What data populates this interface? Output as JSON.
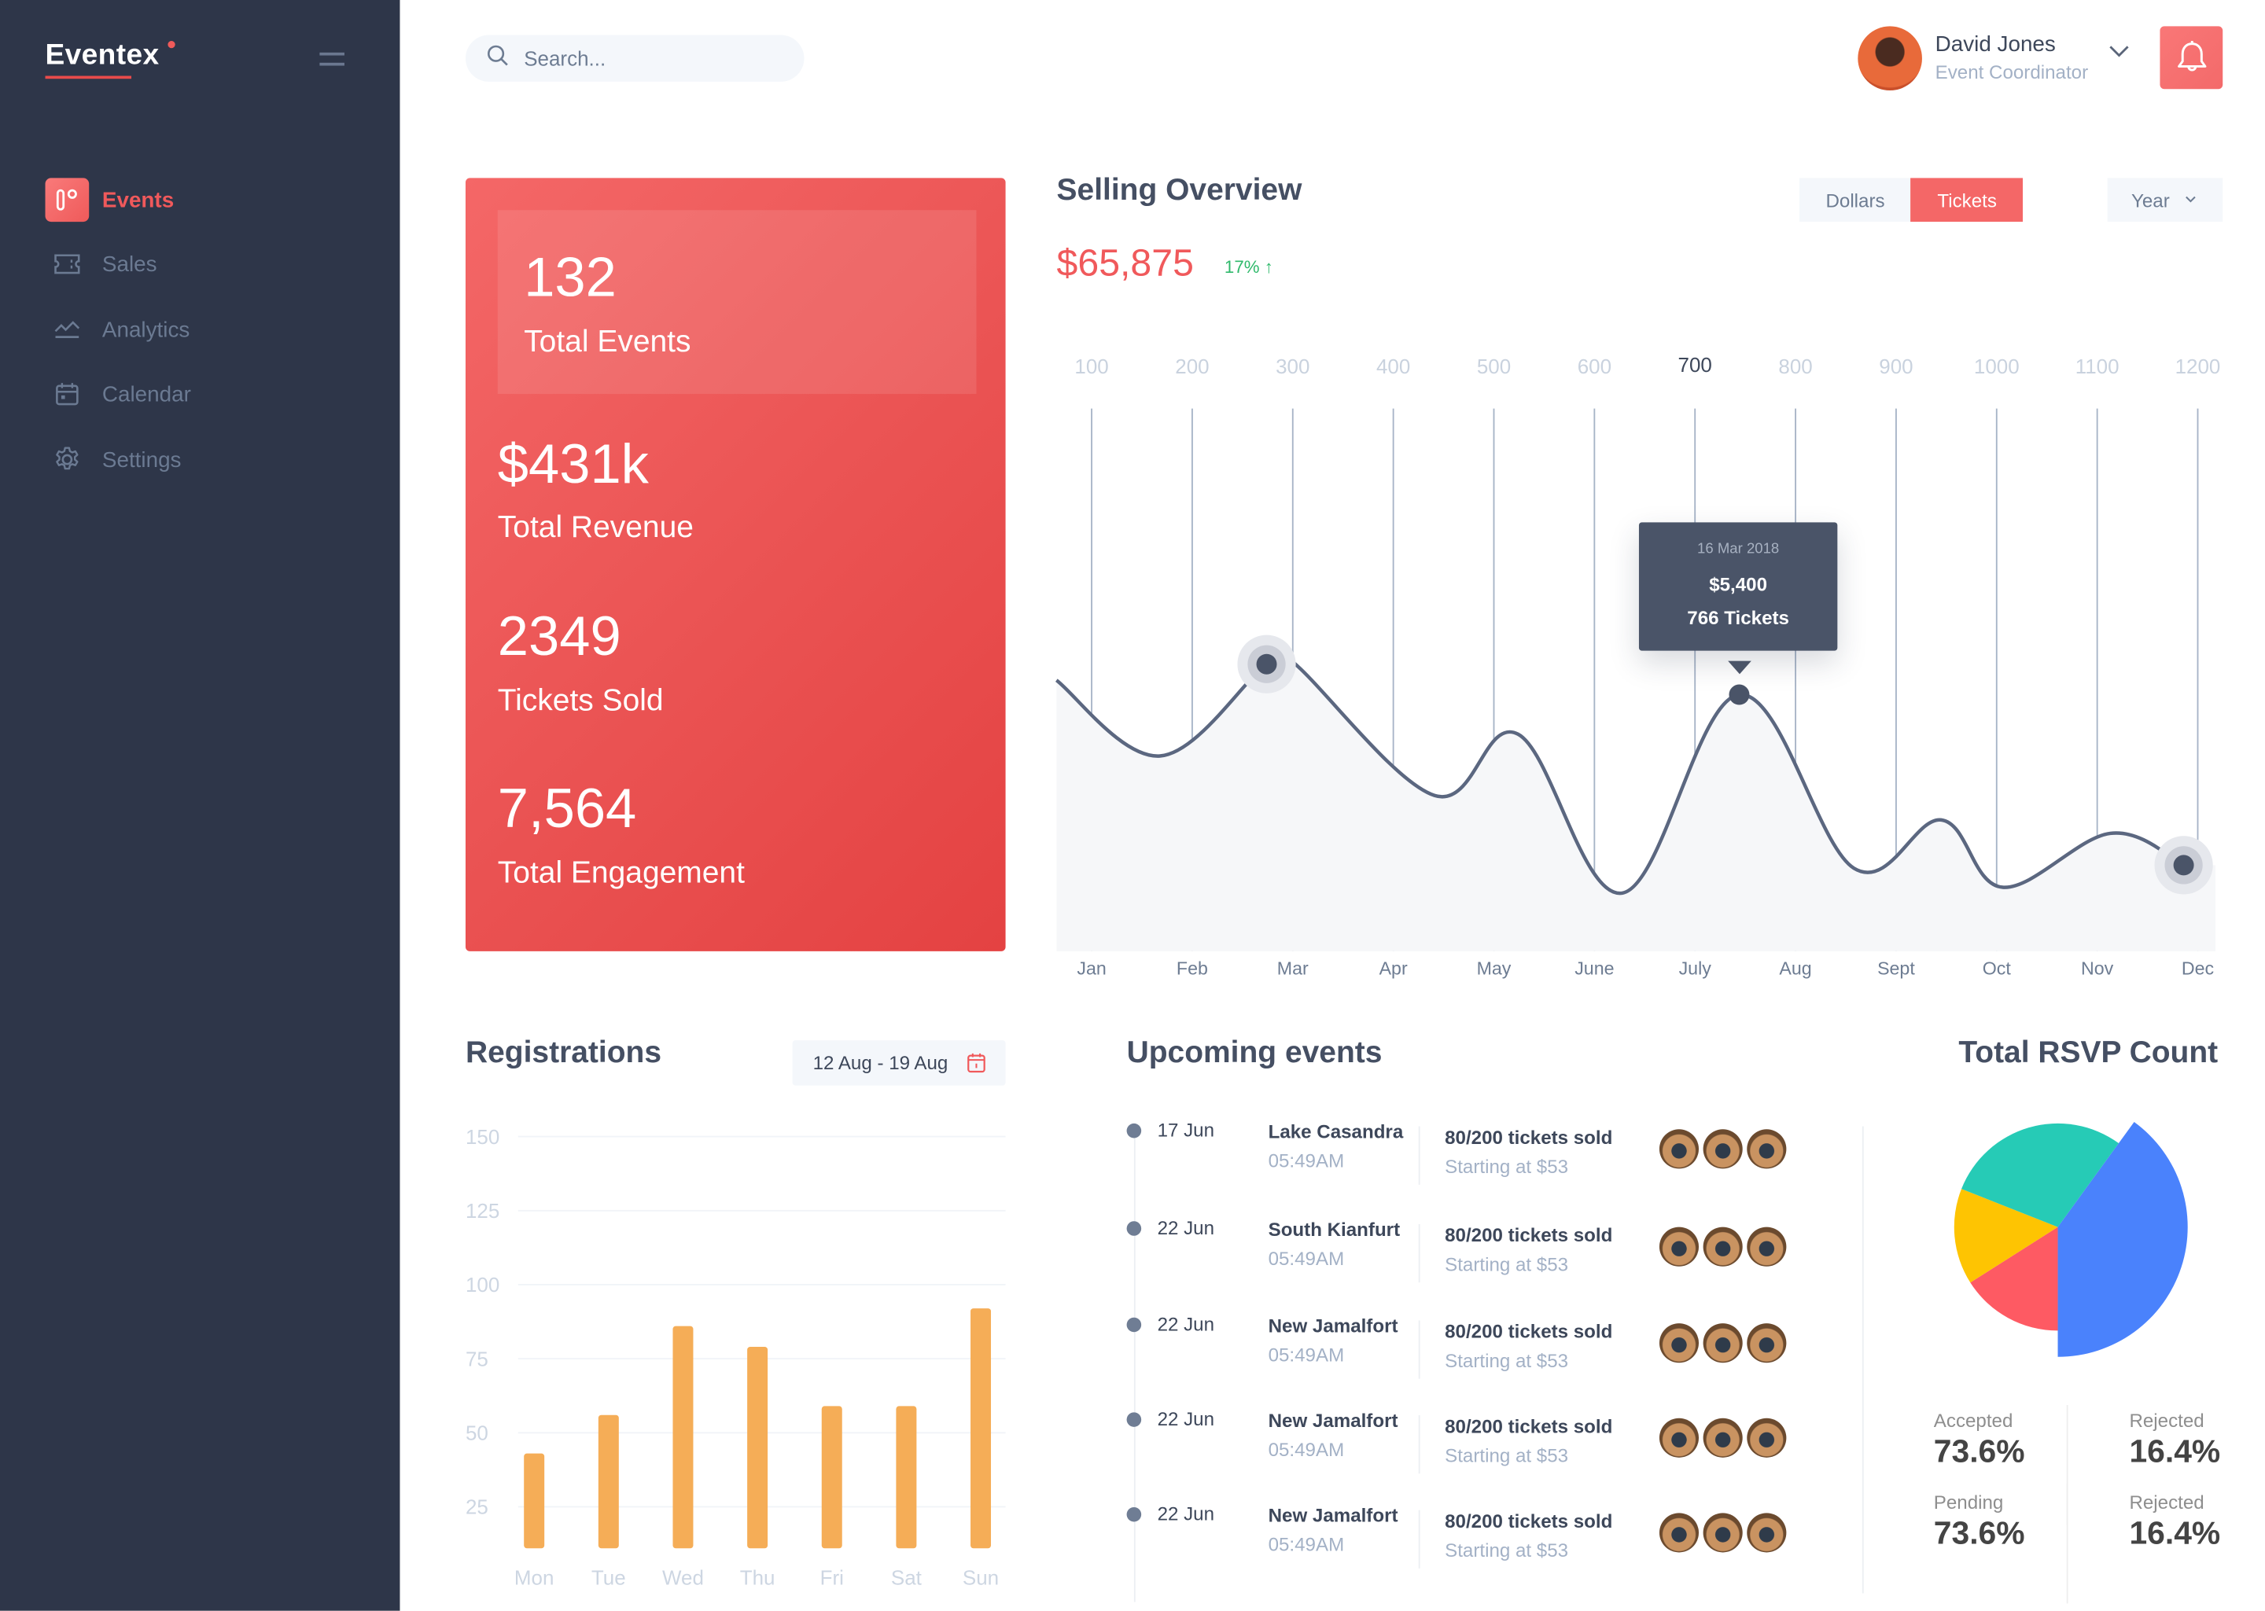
{
  "app": {
    "name": "Eventex"
  },
  "sidebar": {
    "items": [
      {
        "label": "Events",
        "icon": "events-icon",
        "active": true
      },
      {
        "label": "Sales",
        "icon": "ticket-icon",
        "active": false
      },
      {
        "label": "Analytics",
        "icon": "analytics-icon",
        "active": false
      },
      {
        "label": "Calendar",
        "icon": "calendar-icon",
        "active": false
      },
      {
        "label": "Settings",
        "icon": "gear-icon",
        "active": false
      }
    ]
  },
  "header": {
    "search": {
      "placeholder": "Search...",
      "value": ""
    },
    "user": {
      "name": "David Jones",
      "role": "Event Coordinator"
    },
    "notification_icon": "bell-icon"
  },
  "colors": {
    "accent": "#f0595b",
    "sidebar_bg": "#2e3649",
    "bar": "#f5ad57",
    "positive": "#2fb96b",
    "line": "#5b6780"
  },
  "stats": [
    {
      "value": "132",
      "label": "Total Events"
    },
    {
      "value": "$431k",
      "label": "Total Revenue"
    },
    {
      "value": "2349",
      "label": "Tickets Sold"
    },
    {
      "value": "7,564",
      "label": "Total Engagement"
    }
  ],
  "selling": {
    "title": "Selling Overview",
    "amount": "$65,875",
    "change": "17% ↑",
    "toggle": [
      {
        "label": "Dollars",
        "selected": false
      },
      {
        "label": "Tickets",
        "selected": true
      }
    ],
    "period": "Year",
    "tooltip": {
      "date": "16 Mar 2018",
      "amount": "$5,400",
      "tickets": "766 Tickets"
    }
  },
  "registrations": {
    "title": "Registrations",
    "date_range": "12 Aug - 19 Aug"
  },
  "upcoming": {
    "title": "Upcoming events",
    "events": [
      {
        "date": "17 Jun",
        "place": "Lake Casandra",
        "time": "05:49AM",
        "sold": "80/200 tickets sold",
        "price": "Starting at $53"
      },
      {
        "date": "22 Jun",
        "place": "South Kianfurt",
        "time": "05:49AM",
        "sold": "80/200 tickets sold",
        "price": "Starting at $53"
      },
      {
        "date": "22 Jun",
        "place": "New Jamalfort",
        "time": "05:49AM",
        "sold": "80/200 tickets sold",
        "price": "Starting at $53"
      },
      {
        "date": "22 Jun",
        "place": "New Jamalfort",
        "time": "05:49AM",
        "sold": "80/200 tickets sold",
        "price": "Starting at $53"
      },
      {
        "date": "22 Jun",
        "place": "New Jamalfort",
        "time": "05:49AM",
        "sold": "80/200 tickets sold",
        "price": "Starting at $53"
      }
    ]
  },
  "rsvp": {
    "title": "Total RSVP Count",
    "stats": [
      {
        "label": "Accepted",
        "value": "73.6%"
      },
      {
        "label": "Rejected",
        "value": "16.4%"
      },
      {
        "label": "Pending",
        "value": "73.6%"
      },
      {
        "label": "Rejected",
        "value": "16.4%"
      }
    ]
  },
  "chart_data": [
    {
      "type": "line",
      "title": "Selling Overview",
      "categories": [
        "Jan",
        "Feb",
        "Mar",
        "Apr",
        "May",
        "June",
        "July",
        "Aug",
        "Sept",
        "Oct",
        "Nov",
        "Dec"
      ],
      "top_labels": [
        "100",
        "200",
        "300",
        "400",
        "500",
        "600",
        "700",
        "800",
        "900",
        "1000",
        "1100",
        "1200"
      ],
      "highlighted_top_label": "700",
      "series": [
        {
          "name": "Tickets",
          "points": [
            {
              "x": -0.35,
              "y": 809
            },
            {
              "x": 0.68,
              "y": 583
            },
            {
              "x": 1.74,
              "y": 857
            },
            {
              "x": 1.99,
              "y": 866
            },
            {
              "x": 3.41,
              "y": 465
            },
            {
              "x": 4.24,
              "y": 648
            },
            {
              "x": 5.28,
              "y": 174
            },
            {
              "x": 6.44,
              "y": 766
            },
            {
              "x": 7.58,
              "y": 248
            },
            {
              "x": 8.45,
              "y": 392
            },
            {
              "x": 9.06,
              "y": 191
            },
            {
              "x": 10.13,
              "y": 352
            },
            {
              "x": 10.86,
              "y": 257
            }
          ],
          "markers": [
            2,
            7,
            12
          ],
          "active_marker": 7
        }
      ],
      "ylim": [
        0,
        1620
      ],
      "grid": "vertical"
    },
    {
      "type": "bar",
      "title": "Registrations",
      "categories": [
        "Mon",
        "Tue",
        "Wed",
        "Thu",
        "Fri",
        "Sat",
        "Sun"
      ],
      "values": [
        43,
        56,
        86,
        79,
        59,
        59,
        92
      ],
      "yticks": [
        25,
        50,
        75,
        100,
        125,
        150
      ],
      "ylim": [
        11,
        150
      ],
      "grid": "horizontal"
    },
    {
      "type": "pie",
      "title": "Total RSVP Count",
      "slices": [
        {
          "name": "blue",
          "value": 40,
          "color": "#4a82fc",
          "exploded": true
        },
        {
          "name": "red",
          "value": 16,
          "color": "#fe5a63"
        },
        {
          "name": "yellow",
          "value": 15,
          "color": "#fec402"
        },
        {
          "name": "teal",
          "value": 29,
          "color": "#26cbb6"
        }
      ]
    }
  ]
}
